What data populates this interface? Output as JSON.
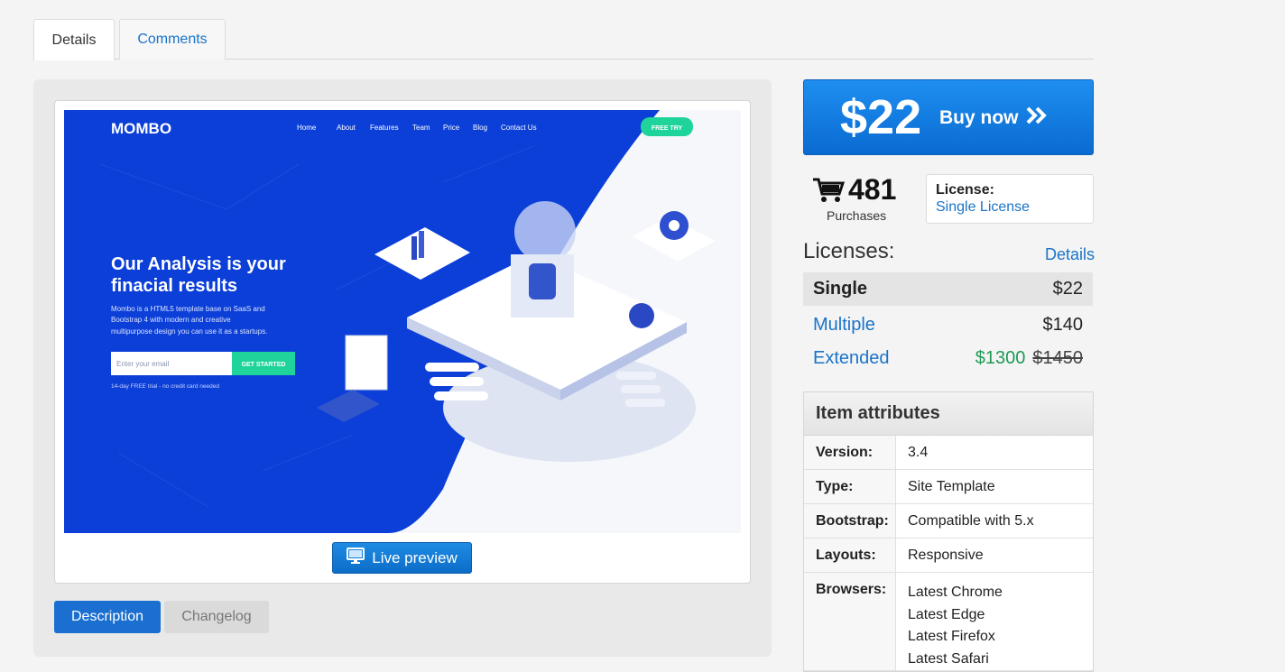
{
  "tabs": {
    "details": "Details",
    "comments": "Comments"
  },
  "preview": {
    "brand": "MOMBO",
    "nav": [
      "Home",
      "About",
      "Features",
      "Team",
      "Price",
      "Blog",
      "Contact Us"
    ],
    "free_try": "FREE TRY",
    "headline_1": "Our Analysis is your",
    "headline_2": "finacial results",
    "body_1": "Mombo is a HTML5 template base on SaaS and",
    "body_2": "Bootstrap 4 with modern and creative",
    "body_3": "multipurpose design you can use it as a startups.",
    "email_placeholder": "Enter your email",
    "cta": "GET STARTED",
    "trial_note": "14-day FREE trial - no credit card needed",
    "live_preview": "Live preview"
  },
  "bottom_tabs": {
    "description": "Description",
    "changelog": "Changelog"
  },
  "buy": {
    "price": "$22",
    "label": "Buy now"
  },
  "purchases": {
    "count": "481",
    "label": "Purchases"
  },
  "license": {
    "label": "License:",
    "value": "Single License"
  },
  "licenses": {
    "title": "Licenses:",
    "details_link": "Details",
    "rows": [
      {
        "name": "Single",
        "price": "$22"
      },
      {
        "name": "Multiple",
        "price": "$140"
      },
      {
        "name": "Extended",
        "price": "$1300",
        "old_price": "$1450"
      }
    ]
  },
  "attributes": {
    "title": "Item attributes",
    "rows": [
      {
        "key": "Version:",
        "value": "3.4"
      },
      {
        "key": "Type:",
        "value": "Site Template"
      },
      {
        "key": "Bootstrap:",
        "value": "Compatible with 5.x"
      },
      {
        "key": "Layouts:",
        "value": "Responsive"
      }
    ],
    "browsers_key": "Browsers:",
    "browsers": [
      "Latest Chrome",
      "Latest Edge",
      "Latest Firefox",
      "Latest Safari"
    ]
  },
  "colors": {
    "accent": "#1a73c9",
    "buy": "#0a6bd1",
    "hero_blue": "#0b3fd8",
    "green": "#1e9a55"
  }
}
